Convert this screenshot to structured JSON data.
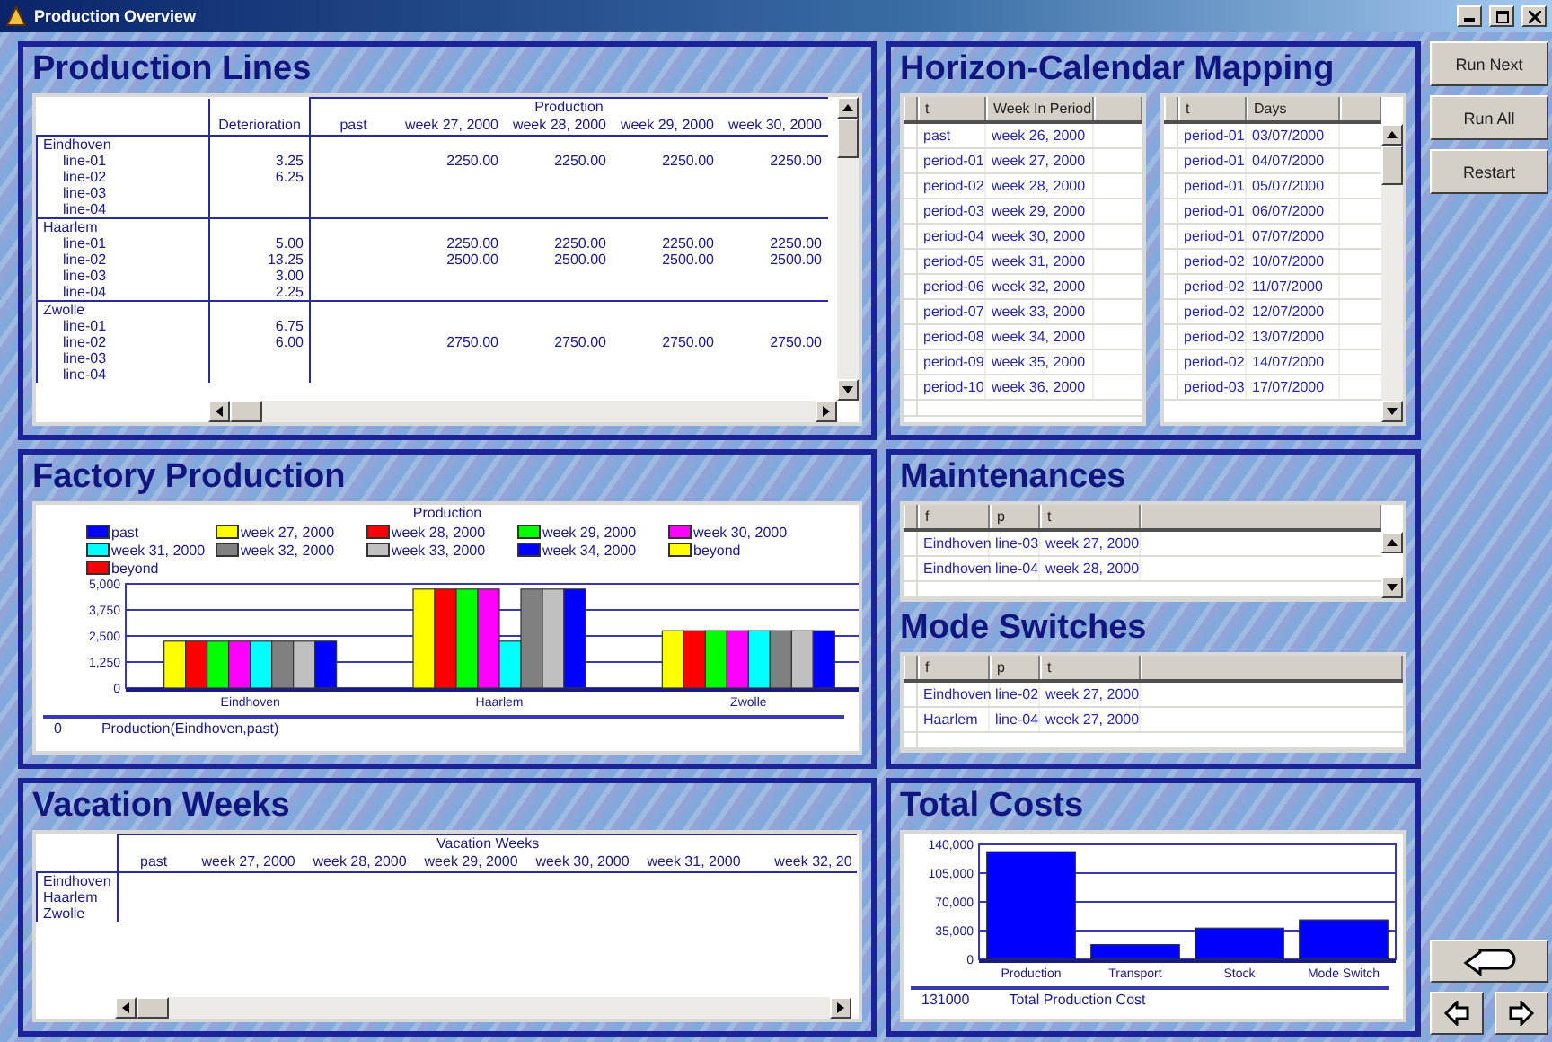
{
  "window": {
    "title": "Production Overview"
  },
  "production_lines": {
    "title": "Production Lines",
    "group_header": "Production",
    "columns": [
      "Deterioration",
      "past",
      "week 27, 2000",
      "week 28, 2000",
      "week 29, 2000",
      "week 30, 2000"
    ],
    "groups": [
      {
        "name": "Eindhoven",
        "rows": [
          {
            "line": "line-01",
            "cells": [
              "3.25",
              null,
              "2250.00",
              "2250.00",
              "2250.00",
              "2250.00"
            ]
          },
          {
            "line": "line-02",
            "cells": [
              "6.25",
              null,
              null,
              null,
              null,
              null
            ]
          },
          {
            "line": "line-03",
            "cells": [
              null,
              null,
              null,
              null,
              null,
              null
            ]
          },
          {
            "line": "line-04",
            "cells": [
              null,
              null,
              null,
              null,
              null,
              null
            ]
          }
        ]
      },
      {
        "name": "Haarlem",
        "rows": [
          {
            "line": "line-01",
            "cells": [
              "5.00",
              null,
              "2250.00",
              "2250.00",
              "2250.00",
              "2250.00"
            ]
          },
          {
            "line": "line-02",
            "cells": [
              "13.25",
              null,
              "2500.00",
              "2500.00",
              "2500.00",
              "2500.00"
            ]
          },
          {
            "line": "line-03",
            "cells": [
              "3.00",
              null,
              null,
              null,
              null,
              null
            ]
          },
          {
            "line": "line-04",
            "cells": [
              "2.25",
              null,
              null,
              null,
              null,
              null
            ]
          }
        ]
      },
      {
        "name": "Zwolle",
        "rows": [
          {
            "line": "line-01",
            "cells": [
              "6.75",
              null,
              null,
              null,
              null,
              null
            ]
          },
          {
            "line": "line-02",
            "cells": [
              "6.00",
              null,
              "2750.00",
              "2750.00",
              "2750.00",
              "2750.00"
            ]
          },
          {
            "line": "line-03",
            "cells": [
              null,
              null,
              null,
              null,
              null,
              null
            ]
          },
          {
            "line": "line-04",
            "cells": [
              null,
              null,
              null,
              null,
              null,
              null
            ]
          }
        ]
      }
    ]
  },
  "horizon_calendar_mapping": {
    "title": "Horizon-Calendar Mapping",
    "week_table": {
      "columns": [
        "t",
        "Week In Period"
      ],
      "rows": [
        [
          "past",
          "week 26, 2000"
        ],
        [
          "period-01",
          "week 27, 2000"
        ],
        [
          "period-02",
          "week 28, 2000"
        ],
        [
          "period-03",
          "week 29, 2000"
        ],
        [
          "period-04",
          "week 30, 2000"
        ],
        [
          "period-05",
          "week 31, 2000"
        ],
        [
          "period-06",
          "week 32, 2000"
        ],
        [
          "period-07",
          "week 33, 2000"
        ],
        [
          "period-08",
          "week 34, 2000"
        ],
        [
          "period-09",
          "week 35, 2000"
        ],
        [
          "period-10",
          "week 36, 2000"
        ]
      ]
    },
    "days_table": {
      "columns": [
        "t",
        "Days"
      ],
      "rows": [
        [
          "period-01",
          "03/07/2000"
        ],
        [
          "period-01",
          "04/07/2000"
        ],
        [
          "period-01",
          "05/07/2000"
        ],
        [
          "period-01",
          "06/07/2000"
        ],
        [
          "period-01",
          "07/07/2000"
        ],
        [
          "period-02",
          "10/07/2000"
        ],
        [
          "period-02",
          "11/07/2000"
        ],
        [
          "period-02",
          "12/07/2000"
        ],
        [
          "period-02",
          "13/07/2000"
        ],
        [
          "period-02",
          "14/07/2000"
        ],
        [
          "period-03",
          "17/07/2000"
        ]
      ]
    }
  },
  "factory_production": {
    "title": "Factory Production",
    "chart_data": {
      "type": "bar",
      "title": "Production",
      "grid": true,
      "categories": [
        "Eindhoven",
        "Haarlem",
        "Zwolle"
      ],
      "ylim": [
        0,
        5000
      ],
      "yticks": [
        {
          "value": 0,
          "label": "0"
        },
        {
          "value": 1250,
          "label": "1,250"
        },
        {
          "value": 2500,
          "label": "2,500"
        },
        {
          "value": 3750,
          "label": "3,750"
        },
        {
          "value": 5000,
          "label": "5,000"
        }
      ],
      "series": [
        {
          "name": "past",
          "color": "#0000ff",
          "values": [
            0,
            0,
            0
          ]
        },
        {
          "name": "week 27, 2000",
          "color": "#ffff00",
          "values": [
            2250,
            4750,
            2750
          ]
        },
        {
          "name": "week 28, 2000",
          "color": "#ff0000",
          "values": [
            2250,
            4750,
            2750
          ]
        },
        {
          "name": "week 29, 2000",
          "color": "#00ff00",
          "values": [
            2250,
            4750,
            2750
          ]
        },
        {
          "name": "week 30, 2000",
          "color": "#ff00ff",
          "values": [
            2250,
            4750,
            2750
          ]
        },
        {
          "name": "week 31, 2000",
          "color": "#00ffff",
          "values": [
            2250,
            2250,
            2750
          ]
        },
        {
          "name": "week 32, 2000",
          "color": "#808080",
          "values": [
            2250,
            4750,
            2750
          ]
        },
        {
          "name": "week 33, 2000",
          "color": "#c0c0c0",
          "values": [
            2250,
            4750,
            2750
          ]
        },
        {
          "name": "week 34, 2000",
          "color": "#0000ff",
          "values": [
            2250,
            4750,
            2750
          ]
        },
        {
          "name": "beyond",
          "color": "#ffff00",
          "values": [
            0,
            0,
            0
          ]
        },
        {
          "name": "beyond",
          "color": "#ff0000",
          "values": [
            0,
            0,
            0
          ]
        }
      ]
    },
    "footer_value": "0",
    "footer_label": "Production(Eindhoven,past)"
  },
  "maintenances": {
    "title": "Maintenances",
    "columns": [
      "f",
      "p",
      "t"
    ],
    "rows": [
      [
        "Eindhoven",
        "line-03",
        "week 27, 2000"
      ],
      [
        "Eindhoven",
        "line-04",
        "week 28, 2000"
      ]
    ]
  },
  "mode_switches": {
    "title": "Mode Switches",
    "columns": [
      "f",
      "p",
      "t"
    ],
    "rows": [
      [
        "Eindhoven",
        "line-02",
        "week 27, 2000"
      ],
      [
        "Haarlem",
        "line-04",
        "week 27, 2000"
      ]
    ]
  },
  "vacation_weeks": {
    "title": "Vacation Weeks",
    "group_header": "Vacation Weeks",
    "columns": [
      "past",
      "week 27, 2000",
      "week 28, 2000",
      "week 29, 2000",
      "week 30, 2000",
      "week 31, 2000",
      "week 32, 20"
    ],
    "rows": [
      "Eindhoven",
      "Haarlem",
      "Zwolle"
    ]
  },
  "total_costs": {
    "title": "Total Costs",
    "chart_data": {
      "type": "bar",
      "grid": true,
      "categories": [
        "Production",
        "Transport",
        "Stock",
        "Mode Switch"
      ],
      "ylim": [
        0,
        140000
      ],
      "yticks": [
        {
          "value": 0,
          "label": "0"
        },
        {
          "value": 35000,
          "label": "35,000"
        },
        {
          "value": 70000,
          "label": "70,000"
        },
        {
          "value": 105000,
          "label": "105,000"
        },
        {
          "value": 140000,
          "label": "140,000"
        }
      ],
      "series": [
        {
          "color": "#0000ff",
          "values": [
            131000,
            18000,
            38000,
            48000
          ]
        }
      ]
    },
    "footer_value": "131000",
    "footer_label": "Total Production Cost"
  },
  "side_buttons": [
    {
      "label": "Run Next"
    },
    {
      "label": "Run All"
    },
    {
      "label": "Restart"
    }
  ]
}
